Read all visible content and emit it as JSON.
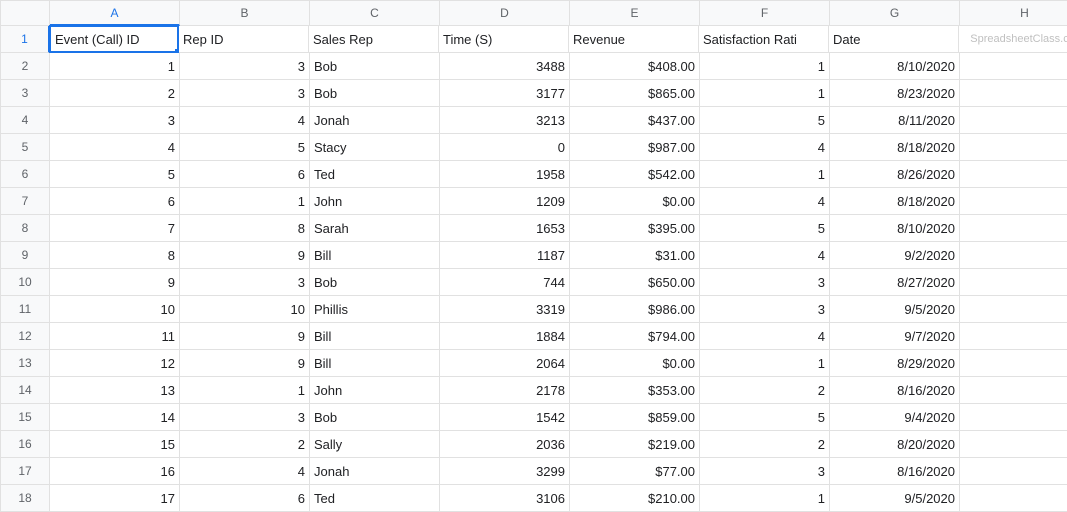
{
  "columns": [
    "A",
    "B",
    "C",
    "D",
    "E",
    "F",
    "G",
    "H"
  ],
  "row_count": 18,
  "selected_cell": "A1",
  "headers": {
    "event_id": "Event (Call) ID",
    "rep_id": "Rep ID",
    "sales_rep": "Sales Rep",
    "time_s": "Time (S)",
    "revenue": "Revenue",
    "satisfaction": "Satisfaction Rati",
    "date": "Date"
  },
  "watermark": "SpreadsheetClass.com",
  "rows": [
    {
      "event_id": "1",
      "rep_id": "3",
      "sales_rep": "Bob",
      "time_s": "3488",
      "revenue": "$408.00",
      "satisfaction": "1",
      "date": "8/10/2020"
    },
    {
      "event_id": "2",
      "rep_id": "3",
      "sales_rep": "Bob",
      "time_s": "3177",
      "revenue": "$865.00",
      "satisfaction": "1",
      "date": "8/23/2020"
    },
    {
      "event_id": "3",
      "rep_id": "4",
      "sales_rep": "Jonah",
      "time_s": "3213",
      "revenue": "$437.00",
      "satisfaction": "5",
      "date": "8/11/2020"
    },
    {
      "event_id": "4",
      "rep_id": "5",
      "sales_rep": "Stacy",
      "time_s": "0",
      "revenue": "$987.00",
      "satisfaction": "4",
      "date": "8/18/2020"
    },
    {
      "event_id": "5",
      "rep_id": "6",
      "sales_rep": "Ted",
      "time_s": "1958",
      "revenue": "$542.00",
      "satisfaction": "1",
      "date": "8/26/2020"
    },
    {
      "event_id": "6",
      "rep_id": "1",
      "sales_rep": "John",
      "time_s": "1209",
      "revenue": "$0.00",
      "satisfaction": "4",
      "date": "8/18/2020"
    },
    {
      "event_id": "7",
      "rep_id": "8",
      "sales_rep": "Sarah",
      "time_s": "1653",
      "revenue": "$395.00",
      "satisfaction": "5",
      "date": "8/10/2020"
    },
    {
      "event_id": "8",
      "rep_id": "9",
      "sales_rep": "Bill",
      "time_s": "1187",
      "revenue": "$31.00",
      "satisfaction": "4",
      "date": "9/2/2020"
    },
    {
      "event_id": "9",
      "rep_id": "3",
      "sales_rep": "Bob",
      "time_s": "744",
      "revenue": "$650.00",
      "satisfaction": "3",
      "date": "8/27/2020"
    },
    {
      "event_id": "10",
      "rep_id": "10",
      "sales_rep": "Phillis",
      "time_s": "3319",
      "revenue": "$986.00",
      "satisfaction": "3",
      "date": "9/5/2020"
    },
    {
      "event_id": "11",
      "rep_id": "9",
      "sales_rep": "Bill",
      "time_s": "1884",
      "revenue": "$794.00",
      "satisfaction": "4",
      "date": "9/7/2020"
    },
    {
      "event_id": "12",
      "rep_id": "9",
      "sales_rep": "Bill",
      "time_s": "2064",
      "revenue": "$0.00",
      "satisfaction": "1",
      "date": "8/29/2020"
    },
    {
      "event_id": "13",
      "rep_id": "1",
      "sales_rep": "John",
      "time_s": "2178",
      "revenue": "$353.00",
      "satisfaction": "2",
      "date": "8/16/2020"
    },
    {
      "event_id": "14",
      "rep_id": "3",
      "sales_rep": "Bob",
      "time_s": "1542",
      "revenue": "$859.00",
      "satisfaction": "5",
      "date": "9/4/2020"
    },
    {
      "event_id": "15",
      "rep_id": "2",
      "sales_rep": "Sally",
      "time_s": "2036",
      "revenue": "$219.00",
      "satisfaction": "2",
      "date": "8/20/2020"
    },
    {
      "event_id": "16",
      "rep_id": "4",
      "sales_rep": "Jonah",
      "time_s": "3299",
      "revenue": "$77.00",
      "satisfaction": "3",
      "date": "8/16/2020"
    },
    {
      "event_id": "17",
      "rep_id": "6",
      "sales_rep": "Ted",
      "time_s": "3106",
      "revenue": "$210.00",
      "satisfaction": "1",
      "date": "9/5/2020"
    }
  ]
}
